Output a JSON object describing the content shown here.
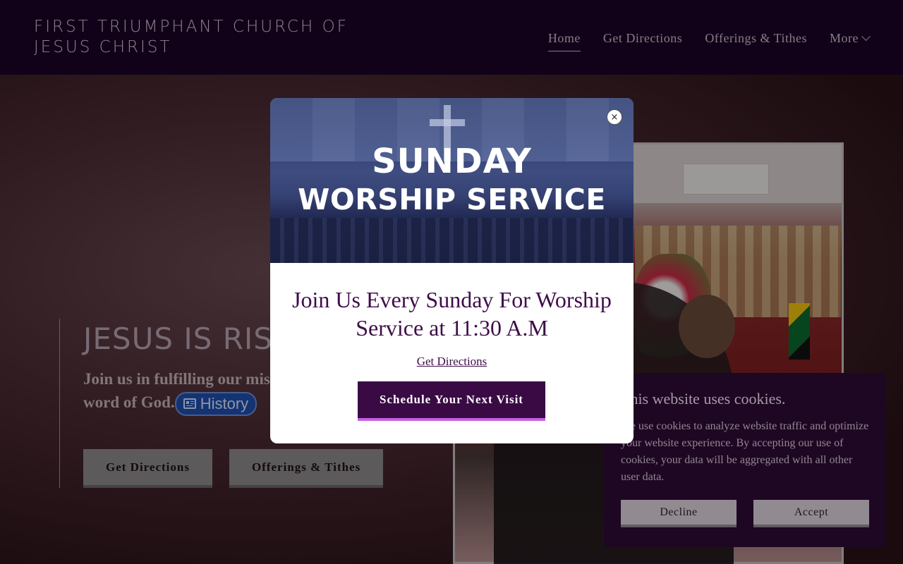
{
  "header": {
    "site_title": "FIRST TRIUMPHANT CHURCH OF JESUS CHRIST",
    "nav": [
      {
        "label": "Home",
        "active": true
      },
      {
        "label": "Get Directions"
      },
      {
        "label": "Offerings & Tithes"
      },
      {
        "label": "More",
        "icon": "chevron-down-icon"
      }
    ]
  },
  "hero": {
    "heading": "JESUS IS RISEN",
    "subtitle": "Join us in fulfilling our mission of spreading the word of God.",
    "subtitle_visible_part1": "Join us in fulfilling our miss",
    "subtitle_visible_part2": "word of God.",
    "history_badge": "History",
    "history_icon": "newspaper-icon",
    "buttons": [
      {
        "label": "Get Directions"
      },
      {
        "label": "Offerings & Tithes"
      }
    ]
  },
  "modal": {
    "banner_line1": "SUNDAY",
    "banner_line2": "WORSHIP SERVICE",
    "heading": "Join Us Every Sunday For Worship Service at 11:30 A.M",
    "link": "Get Directions",
    "cta": "Schedule Your Next Visit",
    "close_symbol": "×"
  },
  "cookie": {
    "title": "This website uses cookies.",
    "text": "We use cookies to analyze website traffic and optimize your website experience. By accepting our use of cookies, your data will be aggregated with all other user data.",
    "decline": "Decline",
    "accept": "Accept"
  },
  "colors": {
    "header_bg": "#1d0427",
    "accent": "#3a0a45",
    "cta_underline": "#c460e0",
    "text_purple": "#3f0d4a"
  }
}
